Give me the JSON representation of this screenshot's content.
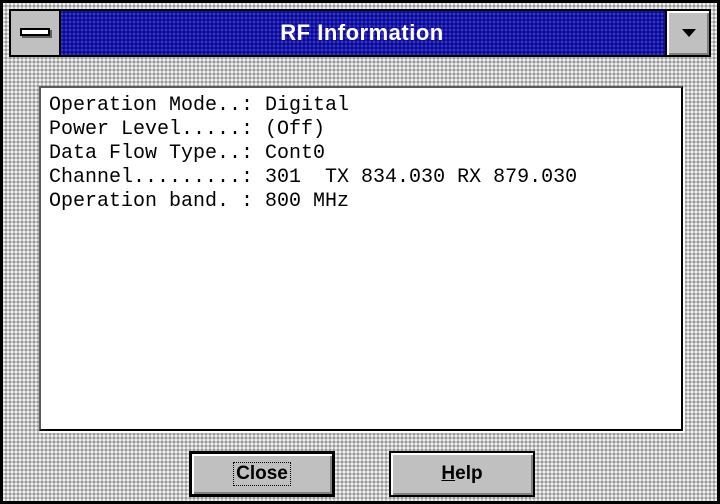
{
  "window": {
    "title": "RF Information"
  },
  "info_lines": [
    "Operation Mode..: Digital",
    "Power Level.....: (Off)",
    "Data Flow Type..: Cont0",
    "Channel.........: 301  TX 834.030 RX 879.030",
    "Operation band. : 800 MHz"
  ],
  "buttons": {
    "close_label": "Close",
    "help_label_mnemonic": "H",
    "help_label_rest": "elp"
  },
  "icons": {
    "system_menu": "system-menu-icon",
    "dropdown": "chevron-down-icon"
  },
  "colors": {
    "titlebar": "#0000a8",
    "window_bg": "#c0c0c0",
    "text_area_bg": "#ffffff"
  }
}
